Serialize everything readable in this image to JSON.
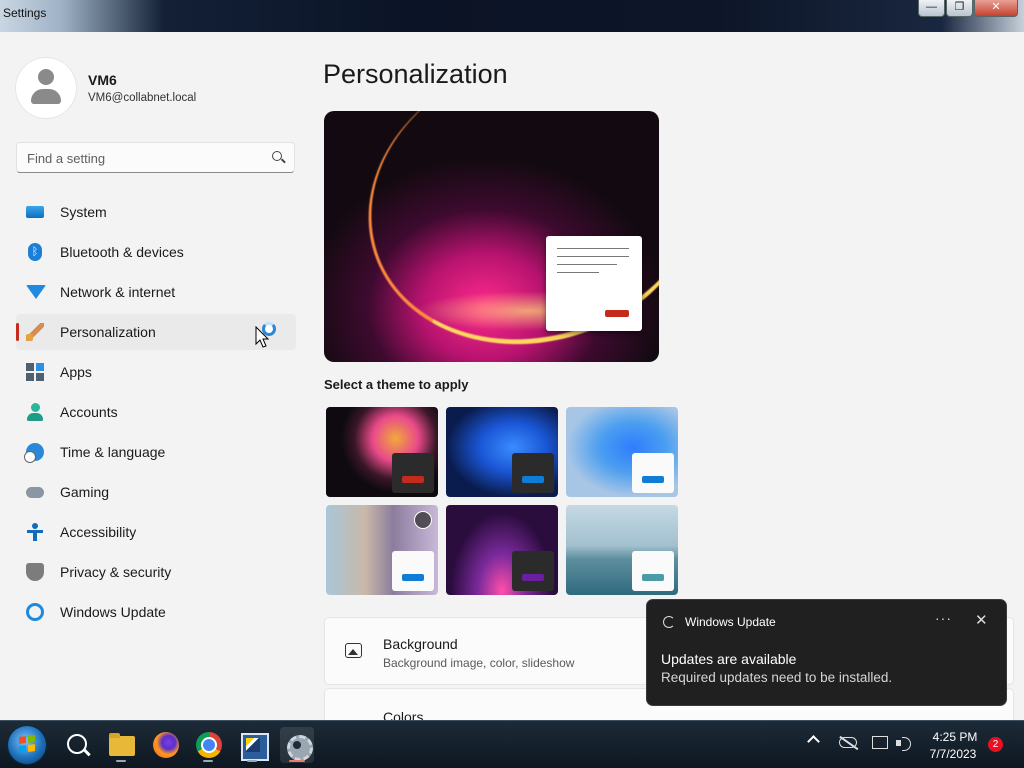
{
  "window": {
    "title": "Settings",
    "controls": {
      "minimize": "—",
      "restore": "❐",
      "close": "✕"
    }
  },
  "user": {
    "name": "VM6",
    "email": "VM6@collabnet.local"
  },
  "search": {
    "placeholder": "Find a setting",
    "value": ""
  },
  "sidebar": {
    "items": [
      {
        "label": "System",
        "icon": "display-icon",
        "active": false
      },
      {
        "label": "Bluetooth & devices",
        "icon": "bluetooth-icon",
        "active": false
      },
      {
        "label": "Network & internet",
        "icon": "wifi-icon",
        "active": false
      },
      {
        "label": "Personalization",
        "icon": "paintbrush-icon",
        "active": true
      },
      {
        "label": "Apps",
        "icon": "apps-icon",
        "active": false
      },
      {
        "label": "Accounts",
        "icon": "person-icon",
        "active": false
      },
      {
        "label": "Time & language",
        "icon": "globe-clock-icon",
        "active": false
      },
      {
        "label": "Gaming",
        "icon": "gamepad-icon",
        "active": false
      },
      {
        "label": "Accessibility",
        "icon": "accessibility-icon",
        "active": false
      },
      {
        "label": "Privacy & security",
        "icon": "shield-icon",
        "active": false
      },
      {
        "label": "Windows Update",
        "icon": "sync-icon",
        "active": false
      }
    ]
  },
  "main": {
    "title": "Personalization",
    "theme_label": "Select a theme to apply",
    "themes": [
      {
        "name": "flower-dark-theme",
        "mini": "dark",
        "accent": "#c42b1c"
      },
      {
        "name": "bloom-dark-theme",
        "mini": "dark",
        "accent": "#0f7dd6"
      },
      {
        "name": "bloom-light-theme",
        "mini": "light",
        "accent": "#0f7dd6"
      },
      {
        "name": "spotlight-theme",
        "mini": "light",
        "accent": "#0f7dd6"
      },
      {
        "name": "glow-dark-theme",
        "mini": "dark",
        "accent": "#6b1fa0"
      },
      {
        "name": "lake-light-theme",
        "mini": "light",
        "accent": "#4a9aa8"
      }
    ],
    "cards": [
      {
        "title": "Background",
        "subtitle": "Background image, color, slideshow"
      },
      {
        "title": "Colors",
        "subtitle": ""
      }
    ]
  },
  "toast": {
    "app": "Windows Update",
    "more": "···",
    "close": "✕",
    "heading": "Updates are available",
    "body": "Required updates need to be installed."
  },
  "taskbar": {
    "apps": [
      "start-button",
      "search-icon",
      "file-explorer-icon",
      "firefox-icon",
      "chrome-icon",
      "app-icon",
      "settings-icon"
    ],
    "time": "4:25 PM",
    "date": "7/7/2023",
    "notifications": "2"
  },
  "colors": {
    "accent": "#c42b1c",
    "toast_bg": "#202020",
    "taskbar_bg": "#0d1720"
  }
}
